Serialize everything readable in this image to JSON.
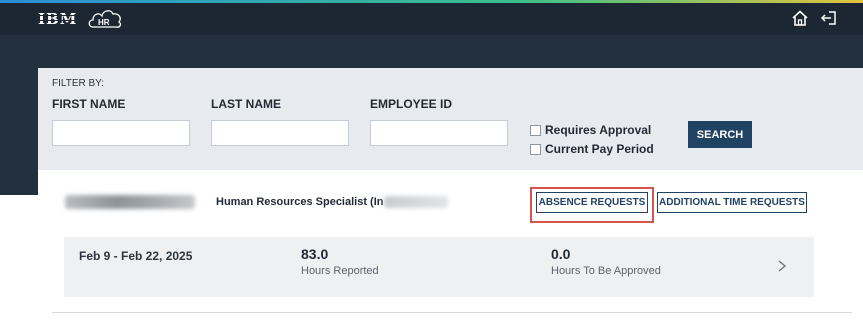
{
  "header": {
    "brand_text": "IBM",
    "hr_logo_text": "HR",
    "icons": [
      "home-icon",
      "logout-icon"
    ]
  },
  "filter": {
    "title": "FILTER BY:",
    "first_name_label": "FIRST NAME",
    "first_name_value": "",
    "last_name_label": "LAST NAME",
    "last_name_value": "",
    "employee_id_label": "EMPLOYEE ID",
    "employee_id_value": "",
    "requires_approval_label": "Requires Approval",
    "current_pay_period_label": "Current Pay Period",
    "search_label": "SEARCH"
  },
  "employee": {
    "job_title": "Human Resources Specialist (In",
    "absence_requests_label": "ABSENCE REQUESTS",
    "additional_time_label": "ADDITIONAL TIME REQUESTS"
  },
  "period": {
    "dates": "Feb 9 - Feb 22, 2025",
    "hours_reported_value": "83.0",
    "hours_reported_label": "Hours Reported",
    "hours_to_approve_value": "0.0",
    "hours_to_approve_label": "Hours To Be Approved"
  },
  "colors": {
    "topbar": "#1c2733",
    "hero": "#23303d",
    "primary_button": "#214363",
    "highlight": "#d9534f",
    "panel": "#e7ebef"
  }
}
